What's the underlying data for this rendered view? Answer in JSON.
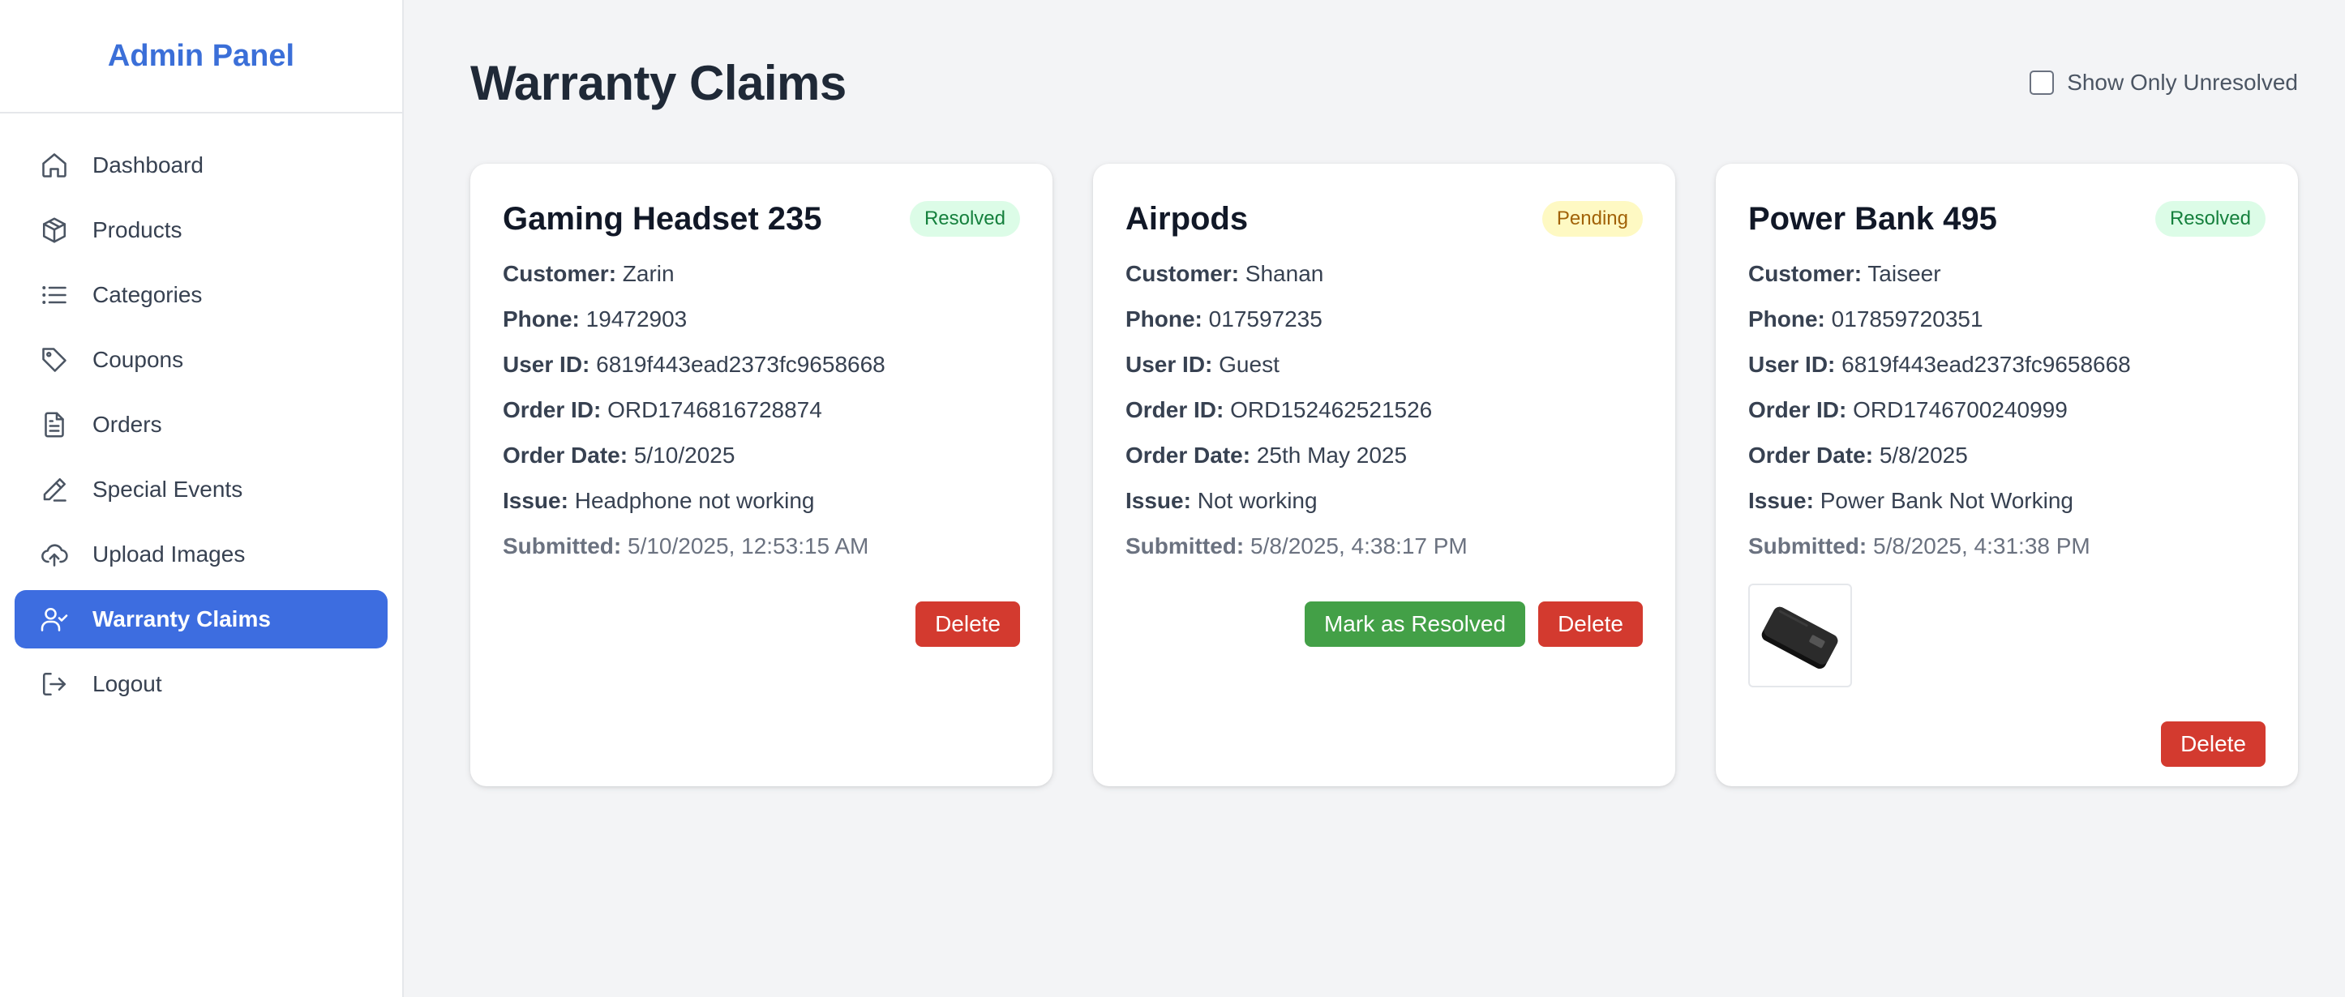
{
  "sidebar": {
    "brand": "Admin Panel",
    "items": [
      {
        "label": "Dashboard",
        "icon": "home-icon"
      },
      {
        "label": "Products",
        "icon": "box-icon"
      },
      {
        "label": "Categories",
        "icon": "list-icon"
      },
      {
        "label": "Coupons",
        "icon": "tag-icon"
      },
      {
        "label": "Orders",
        "icon": "document-icon"
      },
      {
        "label": "Special Events",
        "icon": "pen-icon"
      },
      {
        "label": "Upload Images",
        "icon": "upload-cloud-icon"
      },
      {
        "label": "Warranty Claims",
        "icon": "user-check-icon",
        "active": true
      },
      {
        "label": "Logout",
        "icon": "logout-icon"
      }
    ]
  },
  "header": {
    "title": "Warranty Claims",
    "filter_label": "Show Only Unresolved",
    "filter_checked": false
  },
  "labels": {
    "customer": "Customer:",
    "phone": "Phone:",
    "user_id": "User ID:",
    "order_id": "Order ID:",
    "order_date": "Order Date:",
    "issue": "Issue:",
    "submitted": "Submitted:",
    "delete": "Delete",
    "mark_resolved": "Mark as Resolved"
  },
  "claims": [
    {
      "product": "Gaming Headset 235",
      "status": "Resolved",
      "customer": "Zarin",
      "phone": "19472903",
      "user_id": "6819f443ead2373fc9658668",
      "order_id": "ORD1746816728874",
      "order_date": "5/10/2025",
      "issue": "Headphone not working",
      "submitted": "5/10/2025, 12:53:15 AM"
    },
    {
      "product": "Airpods",
      "status": "Pending",
      "customer": "Shanan",
      "phone": "017597235",
      "user_id": "Guest",
      "order_id": "ORD152462521526",
      "order_date": "25th May 2025",
      "issue": "Not working",
      "submitted": "5/8/2025, 4:38:17 PM"
    },
    {
      "product": "Power Bank 495",
      "status": "Resolved",
      "customer": "Taiseer",
      "phone": "017859720351",
      "user_id": "6819f443ead2373fc9658668",
      "order_id": "ORD1746700240999",
      "order_date": "5/8/2025",
      "issue": "Power Bank Not Working",
      "submitted": "5/8/2025, 4:31:38 PM",
      "attachment": "power-bank-photo"
    }
  ],
  "colors": {
    "accent": "#3d6de0",
    "brand": "#3b6fd8",
    "delete": "#d33a2f",
    "resolve": "#43a047",
    "resolved_badge_bg": "#dcfce7",
    "pending_badge_bg": "#fef9c3"
  }
}
